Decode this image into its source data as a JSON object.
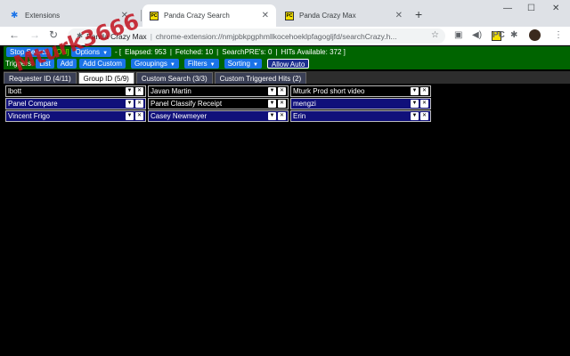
{
  "browser": {
    "tabs": [
      {
        "title": "Extensions",
        "icon": "puzzle-icon",
        "active": false
      },
      {
        "title": "Panda Crazy Search",
        "icon": "panda-icon",
        "active": true
      },
      {
        "title": "Panda Crazy Max",
        "icon": "panda-icon",
        "active": false
      }
    ],
    "omnibox": {
      "site": "Panda Crazy Max",
      "url": "chrome-extension://nmjpbkpgphmllkocehoeklpfagogljfd/searchCrazy.h..."
    }
  },
  "controls": {
    "stop_search": "Stop Search",
    "status": "[ON]",
    "options": "Options",
    "elapsed": "Elapsed: 953",
    "fetched": "Fetched: 10",
    "searchpres": "SearchPRE's: 0",
    "hits_available": "HITs Available: 372 ]",
    "open_bracket": "- ["
  },
  "triggers": {
    "label": "Triggers:",
    "list": "List",
    "add": "Add",
    "add_custom": "Add Custom",
    "groupings": "Groupings",
    "filters": "Filters",
    "sorting": "Sorting",
    "allow_auto": "Allow Auto"
  },
  "panel_tabs": [
    {
      "label": "Requester ID (4/11)",
      "active": false
    },
    {
      "label": "Group ID (5/9)",
      "active": true
    },
    {
      "label": "Custom Search (3/3)",
      "active": false
    },
    {
      "label": "Custom Triggered Hits (2)",
      "active": false
    }
  ],
  "cards": [
    {
      "name": "lbott",
      "enabled": false
    },
    {
      "name": "Javan Martin",
      "enabled": false
    },
    {
      "name": "Mturk Prod short video",
      "enabled": false
    },
    {
      "name": "Panel Compare",
      "enabled": true
    },
    {
      "name": "Panel Classify Receipt",
      "enabled": false
    },
    {
      "name": "mengzi",
      "enabled": true
    },
    {
      "name": "Vincent Frigo",
      "enabled": true
    },
    {
      "name": "Casey Newmeyer",
      "enabled": true
    },
    {
      "name": "Erin",
      "enabled": true
    }
  ],
  "watermark": "Mturk3666"
}
